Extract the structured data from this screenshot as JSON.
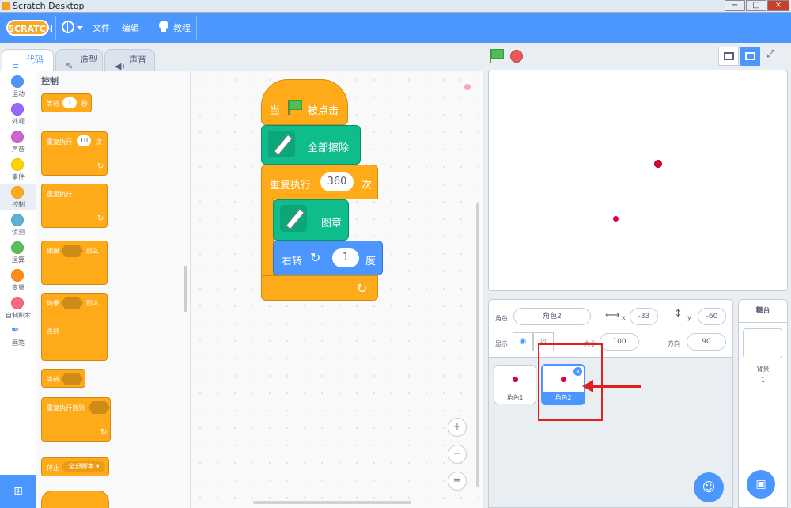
{
  "window": {
    "title": "Scratch Desktop",
    "min": "−",
    "max": "□",
    "close": "×"
  },
  "menu": {
    "logo": "SCRATCH",
    "file": "文件",
    "edit": "编辑",
    "tutorials": "教程"
  },
  "tabs": {
    "code": "代码",
    "costumes": "造型",
    "sounds": "声音"
  },
  "categories": [
    {
      "label": "运动",
      "color": "#4c97ff"
    },
    {
      "label": "外观",
      "color": "#9966ff"
    },
    {
      "label": "声音",
      "color": "#cf63cf"
    },
    {
      "label": "事件",
      "color": "#ffd500"
    },
    {
      "label": "控制",
      "color": "#ffab19"
    },
    {
      "label": "侦测",
      "color": "#5cb1d6"
    },
    {
      "label": "运算",
      "color": "#59c059"
    },
    {
      "label": "变量",
      "color": "#ff8c1a"
    },
    {
      "label": "自制积木",
      "color": "#ff6680"
    },
    {
      "label": "画笔",
      "color": "#0fbd8c"
    }
  ],
  "palette": {
    "title": "控制",
    "wait": "等待",
    "wait_val": "1",
    "wait_unit": "秒",
    "repeat": "重复执行",
    "repeat_val": "10",
    "repeat_unit": "次",
    "forever": "重复执行",
    "if": "如果",
    "then": "那么",
    "if2": "如果",
    "then2": "那么",
    "else": "否则",
    "wait_until": "等待",
    "repeat_until": "重复执行直到",
    "stop": "停止",
    "stop_opt": "全部脚本 ▾"
  },
  "script": {
    "when": "当",
    "clicked": "被点击",
    "clear": "全部擦除",
    "repeat": "重复执行",
    "repeat_val": "360",
    "repeat_unit": "次",
    "stamp": "图章",
    "turn": "右转",
    "turn_val": "1",
    "turn_unit": "度"
  },
  "sprite_info": {
    "sprite_label": "角色",
    "sprite_name": "角色2",
    "x_label": "x",
    "x_val": "-33",
    "y_label": "y",
    "y_val": "-60",
    "show_label": "显示",
    "size_label": "大小",
    "size_val": "100",
    "dir_label": "方向",
    "dir_val": "90"
  },
  "sprites": [
    {
      "name": "角色1"
    },
    {
      "name": "角色2"
    }
  ],
  "stage_pane": {
    "title": "舞台",
    "backdrop_label": "背景",
    "backdrop_count": "1"
  },
  "colors": {
    "accent": "#4c97ff",
    "control": "#ffab19",
    "pen": "#0fbd8c",
    "highlight": "#e02020"
  }
}
